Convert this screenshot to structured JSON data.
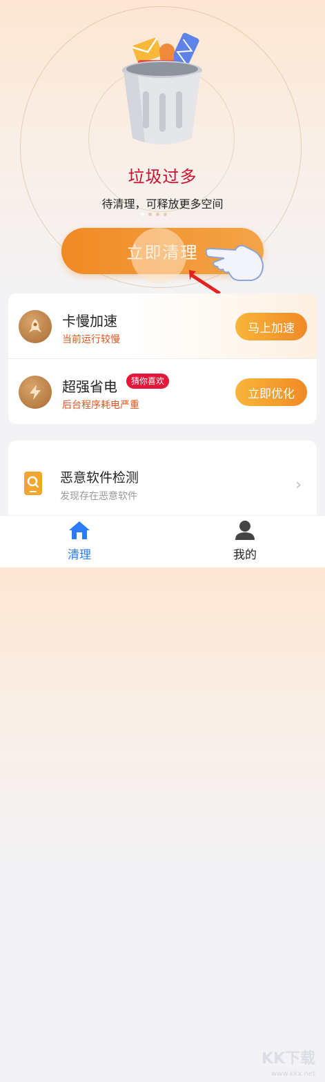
{
  "hero": {
    "title": "垃圾过多",
    "subtitle": "待清理，可释放更多空间",
    "clean_button": "立即清理",
    "pager_dots": 4,
    "active_dot": 0
  },
  "tasks": [
    {
      "title": "卡慢加速",
      "subtitle": "当前运行较慢",
      "button": "马上加速",
      "icon": "rocket-icon"
    },
    {
      "title": "超强省电",
      "badge": "猜你喜欢",
      "subtitle": "后台程序耗电严重",
      "button": "立即优化",
      "icon": "lightning-icon"
    }
  ],
  "malware": {
    "title": "恶意软件检测",
    "subtitle": "发现存在恶意软件",
    "icon": "phone-search-icon"
  },
  "tabbar": {
    "home": "清理",
    "mine": "我的"
  },
  "watermark": {
    "text": "KK下载",
    "url_text": "www.kkx.net"
  },
  "colors": {
    "accent": "#f08a25",
    "title_red": "#c8102e",
    "tab_active": "#2b7cf6",
    "subtitle_orange": "#e2541c"
  }
}
